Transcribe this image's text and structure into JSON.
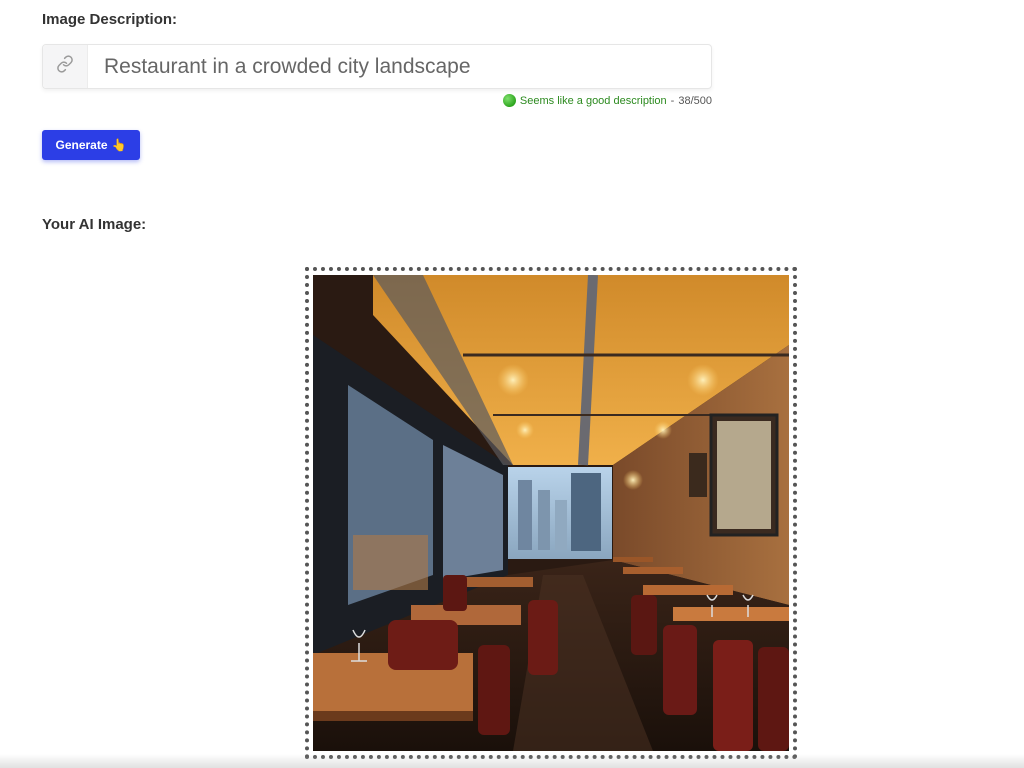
{
  "description": {
    "label": "Image Description:",
    "value": "Restaurant in a crowded city landscape",
    "addon_icon": "link-icon"
  },
  "validation": {
    "status_icon": "green-circle",
    "message": "Seems like a good description",
    "separator": "-",
    "count": "38/500",
    "color": "#2c8a1f"
  },
  "generate": {
    "label": "Generate",
    "emoji": "👆",
    "color": "#2c3ee6"
  },
  "result": {
    "label": "Your AI Image:",
    "image_subject": "restaurant-interior-image"
  }
}
